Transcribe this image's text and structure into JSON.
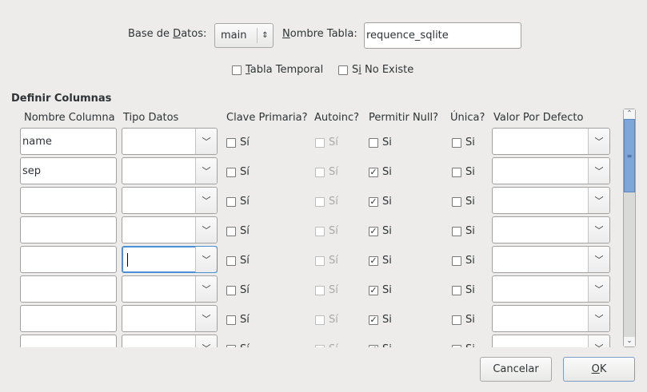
{
  "header": {
    "db_label_pre": "Base de ",
    "db_label_u": "D",
    "db_label_post": "atos:",
    "db_value": "main",
    "table_label_u": "N",
    "table_label_post": "ombre Tabla:",
    "table_value": "requence_sqlite",
    "temp_u": "T",
    "temp_post": "abla Temporal",
    "temp_checked": false,
    "ifnot_pre": "S",
    "ifnot_u": "i",
    "ifnot_post": " No Existe",
    "ifnot_checked": false
  },
  "section_title": "Definir Columnas",
  "columns": {
    "name": "Nombre Columna",
    "type": "Tipo Datos",
    "pk": "Clave Primaria?",
    "ai": "Autoinc?",
    "null": "Permitir Null?",
    "unique": "Única?",
    "default": "Valor Por Defecto"
  },
  "row_labels": {
    "pk": "Sí",
    "ai": "Sí",
    "null": "Si",
    "unique": "Si"
  },
  "rows": [
    {
      "name": "name",
      "type": "",
      "pk": false,
      "ai": false,
      "null": false,
      "unique": false,
      "default": ""
    },
    {
      "name": "sep",
      "type": "",
      "pk": false,
      "ai": false,
      "null": true,
      "unique": false,
      "default": ""
    },
    {
      "name": "",
      "type": "",
      "pk": false,
      "ai": false,
      "null": true,
      "unique": false,
      "default": ""
    },
    {
      "name": "",
      "type": "",
      "pk": false,
      "ai": false,
      "null": true,
      "unique": false,
      "default": ""
    },
    {
      "name": "",
      "type": "",
      "pk": false,
      "ai": false,
      "null": true,
      "unique": false,
      "default": "",
      "type_focused": true
    },
    {
      "name": "",
      "type": "",
      "pk": false,
      "ai": false,
      "null": true,
      "unique": false,
      "default": ""
    },
    {
      "name": "",
      "type": "",
      "pk": false,
      "ai": false,
      "null": true,
      "unique": false,
      "default": ""
    },
    {
      "name": "",
      "type": "",
      "pk": false,
      "ai": false,
      "null": true,
      "unique": false,
      "default": ""
    }
  ],
  "buttons": {
    "cancel": "Cancelar",
    "ok_u": "O",
    "ok_post": "K"
  },
  "icons": {
    "spin": "updown-icon",
    "combo": "chevron-down-icon",
    "check": "checkmark-icon"
  },
  "colors": {
    "scroll_thumb": "#7fa6d9",
    "focus": "#4a90d9"
  }
}
